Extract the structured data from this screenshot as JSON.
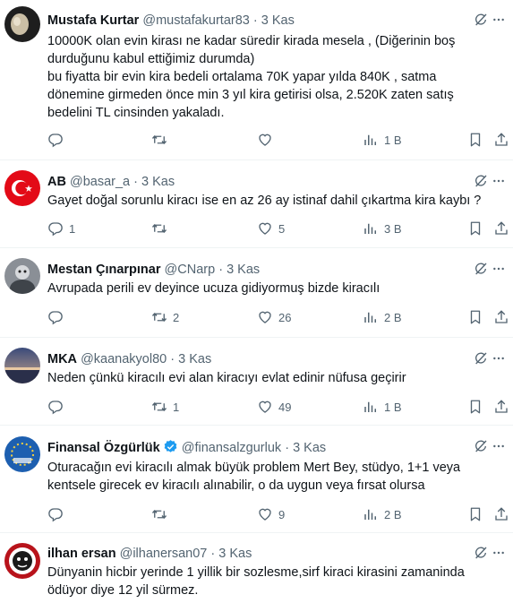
{
  "tweets": [
    {
      "name": "Mustafa Kurtar",
      "handle": "@mustafakurtar83",
      "sep": "·",
      "time": "3 Kas",
      "lines": [
        "10000K olan evin kirası ne kadar süredir kirada mesela , (Diğerinin boş",
        "durduğunu kabul ettiğimiz durumda)",
        "bu fiyatta bir evin kira bedeli ortalama 70K yapar yılda 840K , satma",
        "dönemine girmeden önce min 3 yıl kira getirisi olsa, 2.520K zaten satış",
        "bedelini TL cinsinden yakaladı."
      ],
      "replies": "",
      "retweets": "",
      "likes": "",
      "views": "1 B"
    },
    {
      "name": "AB",
      "handle": "@basar_a",
      "sep": "·",
      "time": "3 Kas",
      "lines": [
        "Gayet doğal sorunlu kiracı ise en az 26 ay istinaf dahil çıkartma kira kaybı ?"
      ],
      "replies": "1",
      "retweets": "",
      "likes": "5",
      "views": "3 B"
    },
    {
      "name": "Mestan Çınarpınar",
      "handle": "@CNarp",
      "sep": "·",
      "time": "3 Kas",
      "lines": [
        "Avrupada perili ev deyince ucuza gidiyormuş bizde kiracılı"
      ],
      "replies": "",
      "retweets": "2",
      "likes": "26",
      "views": "2 B"
    },
    {
      "name": "MKA",
      "handle": "@kaanakyol80",
      "sep": "·",
      "time": "3 Kas",
      "lines": [
        "Neden çünkü kiracılı evi alan kiracıyı evlat edinir nüfusa geçirir"
      ],
      "replies": "",
      "retweets": "1",
      "likes": "49",
      "views": "1 B"
    },
    {
      "name": "Finansal Özgürlük",
      "handle": "@finansalzgurluk",
      "sep": "·",
      "time": "3 Kas",
      "lines": [
        "Oturacağın evi kiracılı almak büyük problem Mert Bey, stüdyo, 1+1 veya",
        "kentsele girecek ev kiracılı alınabilir, o da uygun veya fırsat olursa"
      ],
      "replies": "",
      "retweets": "",
      "likes": "9",
      "views": "2 B"
    },
    {
      "name": "ilhan ersan",
      "handle": "@ilhanersan07",
      "sep": "·",
      "time": "3 Kas",
      "lines": [
        "Dünyanin hicbir yerinde 1 yillik bir sozlesme,sirf kiraci kirasini zamaninda",
        "ödüyor diye 12 yil sürmez."
      ]
    }
  ],
  "colors": {
    "text": "#0f1419",
    "muted": "#536471",
    "divider": "#eff3f4",
    "verified": "#1d9bf0"
  }
}
